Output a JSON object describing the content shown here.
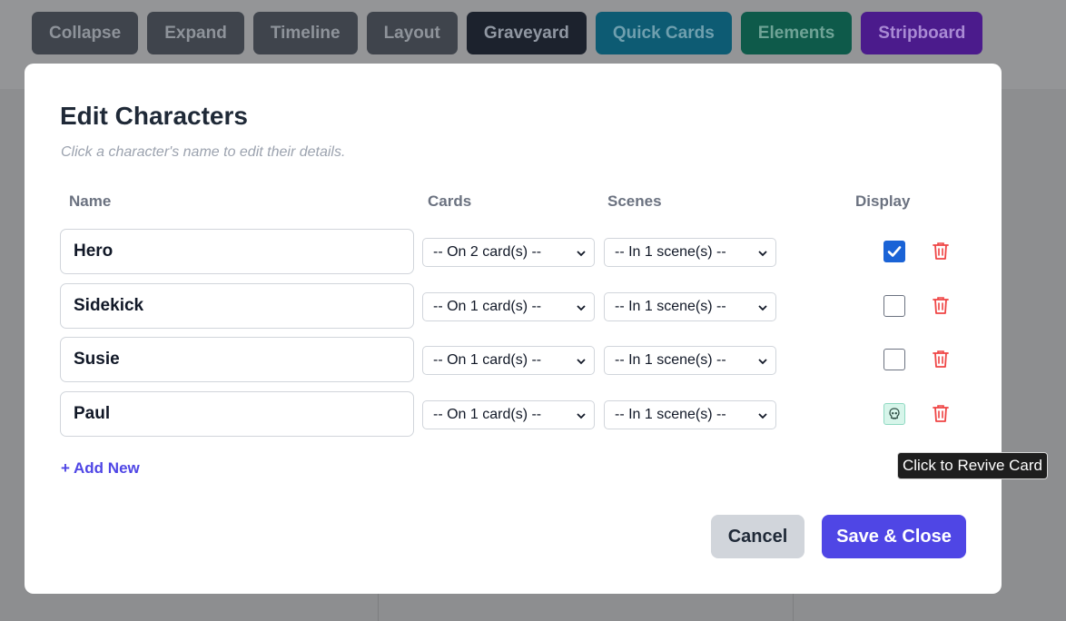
{
  "toolbar": {
    "buttons": [
      {
        "label": "Collapse"
      },
      {
        "label": "Expand"
      },
      {
        "label": "Timeline"
      },
      {
        "label": "Layout"
      },
      {
        "label": "Graveyard"
      },
      {
        "label": "Quick Cards"
      },
      {
        "label": "Elements"
      },
      {
        "label": "Stripboard"
      }
    ]
  },
  "modal": {
    "title": "Edit Characters",
    "subtitle": "Click a character's name to edit their details.",
    "columns": {
      "name": "Name",
      "cards": "Cards",
      "scenes": "Scenes",
      "display": "Display"
    },
    "rows": [
      {
        "name": "Hero",
        "cards": "-- On 2 card(s) --",
        "scenes": "-- In 1 scene(s) --",
        "display": "checked"
      },
      {
        "name": "Sidekick",
        "cards": "-- On 1 card(s) --",
        "scenes": "-- In 1 scene(s) --",
        "display": "unchecked"
      },
      {
        "name": "Susie",
        "cards": "-- On 1 card(s) --",
        "scenes": "-- In 1 scene(s) --",
        "display": "unchecked"
      },
      {
        "name": "Paul",
        "cards": "-- On 1 card(s) --",
        "scenes": "-- In 1 scene(s) --",
        "display": "graveyard"
      }
    ],
    "add_new": "+ Add New",
    "cancel_label": "Cancel",
    "save_label": "Save & Close"
  },
  "tooltip": {
    "text": "Click to Revive Card"
  },
  "colors": {
    "accent": "#4f46e5",
    "checkbox_checked": "#1a63d6",
    "trash": "#ef4444",
    "skull_bg": "#d7f5ea"
  },
  "icons": {
    "trash": "trash-icon",
    "skull": "skull-icon",
    "chevron": "chevron-down-icon",
    "check": "check-icon"
  }
}
